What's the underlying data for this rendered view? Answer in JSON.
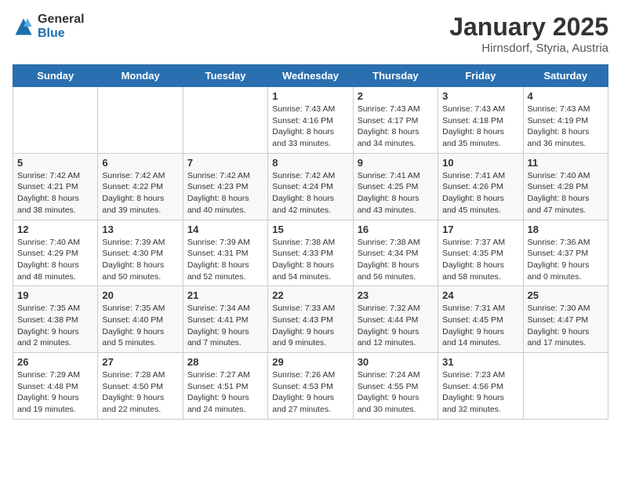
{
  "header": {
    "logo_general": "General",
    "logo_blue": "Blue",
    "month_title": "January 2025",
    "subtitle": "Hirnsdorf, Styria, Austria"
  },
  "days_of_week": [
    "Sunday",
    "Monday",
    "Tuesday",
    "Wednesday",
    "Thursday",
    "Friday",
    "Saturday"
  ],
  "weeks": [
    [
      {
        "day": "",
        "info": ""
      },
      {
        "day": "",
        "info": ""
      },
      {
        "day": "",
        "info": ""
      },
      {
        "day": "1",
        "info": "Sunrise: 7:43 AM\nSunset: 4:16 PM\nDaylight: 8 hours and 33 minutes."
      },
      {
        "day": "2",
        "info": "Sunrise: 7:43 AM\nSunset: 4:17 PM\nDaylight: 8 hours and 34 minutes."
      },
      {
        "day": "3",
        "info": "Sunrise: 7:43 AM\nSunset: 4:18 PM\nDaylight: 8 hours and 35 minutes."
      },
      {
        "day": "4",
        "info": "Sunrise: 7:43 AM\nSunset: 4:19 PM\nDaylight: 8 hours and 36 minutes."
      }
    ],
    [
      {
        "day": "5",
        "info": "Sunrise: 7:42 AM\nSunset: 4:21 PM\nDaylight: 8 hours and 38 minutes."
      },
      {
        "day": "6",
        "info": "Sunrise: 7:42 AM\nSunset: 4:22 PM\nDaylight: 8 hours and 39 minutes."
      },
      {
        "day": "7",
        "info": "Sunrise: 7:42 AM\nSunset: 4:23 PM\nDaylight: 8 hours and 40 minutes."
      },
      {
        "day": "8",
        "info": "Sunrise: 7:42 AM\nSunset: 4:24 PM\nDaylight: 8 hours and 42 minutes."
      },
      {
        "day": "9",
        "info": "Sunrise: 7:41 AM\nSunset: 4:25 PM\nDaylight: 8 hours and 43 minutes."
      },
      {
        "day": "10",
        "info": "Sunrise: 7:41 AM\nSunset: 4:26 PM\nDaylight: 8 hours and 45 minutes."
      },
      {
        "day": "11",
        "info": "Sunrise: 7:40 AM\nSunset: 4:28 PM\nDaylight: 8 hours and 47 minutes."
      }
    ],
    [
      {
        "day": "12",
        "info": "Sunrise: 7:40 AM\nSunset: 4:29 PM\nDaylight: 8 hours and 48 minutes."
      },
      {
        "day": "13",
        "info": "Sunrise: 7:39 AM\nSunset: 4:30 PM\nDaylight: 8 hours and 50 minutes."
      },
      {
        "day": "14",
        "info": "Sunrise: 7:39 AM\nSunset: 4:31 PM\nDaylight: 8 hours and 52 minutes."
      },
      {
        "day": "15",
        "info": "Sunrise: 7:38 AM\nSunset: 4:33 PM\nDaylight: 8 hours and 54 minutes."
      },
      {
        "day": "16",
        "info": "Sunrise: 7:38 AM\nSunset: 4:34 PM\nDaylight: 8 hours and 56 minutes."
      },
      {
        "day": "17",
        "info": "Sunrise: 7:37 AM\nSunset: 4:35 PM\nDaylight: 8 hours and 58 minutes."
      },
      {
        "day": "18",
        "info": "Sunrise: 7:36 AM\nSunset: 4:37 PM\nDaylight: 9 hours and 0 minutes."
      }
    ],
    [
      {
        "day": "19",
        "info": "Sunrise: 7:35 AM\nSunset: 4:38 PM\nDaylight: 9 hours and 2 minutes."
      },
      {
        "day": "20",
        "info": "Sunrise: 7:35 AM\nSunset: 4:40 PM\nDaylight: 9 hours and 5 minutes."
      },
      {
        "day": "21",
        "info": "Sunrise: 7:34 AM\nSunset: 4:41 PM\nDaylight: 9 hours and 7 minutes."
      },
      {
        "day": "22",
        "info": "Sunrise: 7:33 AM\nSunset: 4:43 PM\nDaylight: 9 hours and 9 minutes."
      },
      {
        "day": "23",
        "info": "Sunrise: 7:32 AM\nSunset: 4:44 PM\nDaylight: 9 hours and 12 minutes."
      },
      {
        "day": "24",
        "info": "Sunrise: 7:31 AM\nSunset: 4:45 PM\nDaylight: 9 hours and 14 minutes."
      },
      {
        "day": "25",
        "info": "Sunrise: 7:30 AM\nSunset: 4:47 PM\nDaylight: 9 hours and 17 minutes."
      }
    ],
    [
      {
        "day": "26",
        "info": "Sunrise: 7:29 AM\nSunset: 4:48 PM\nDaylight: 9 hours and 19 minutes."
      },
      {
        "day": "27",
        "info": "Sunrise: 7:28 AM\nSunset: 4:50 PM\nDaylight: 9 hours and 22 minutes."
      },
      {
        "day": "28",
        "info": "Sunrise: 7:27 AM\nSunset: 4:51 PM\nDaylight: 9 hours and 24 minutes."
      },
      {
        "day": "29",
        "info": "Sunrise: 7:26 AM\nSunset: 4:53 PM\nDaylight: 9 hours and 27 minutes."
      },
      {
        "day": "30",
        "info": "Sunrise: 7:24 AM\nSunset: 4:55 PM\nDaylight: 9 hours and 30 minutes."
      },
      {
        "day": "31",
        "info": "Sunrise: 7:23 AM\nSunset: 4:56 PM\nDaylight: 9 hours and 32 minutes."
      },
      {
        "day": "",
        "info": ""
      }
    ]
  ]
}
